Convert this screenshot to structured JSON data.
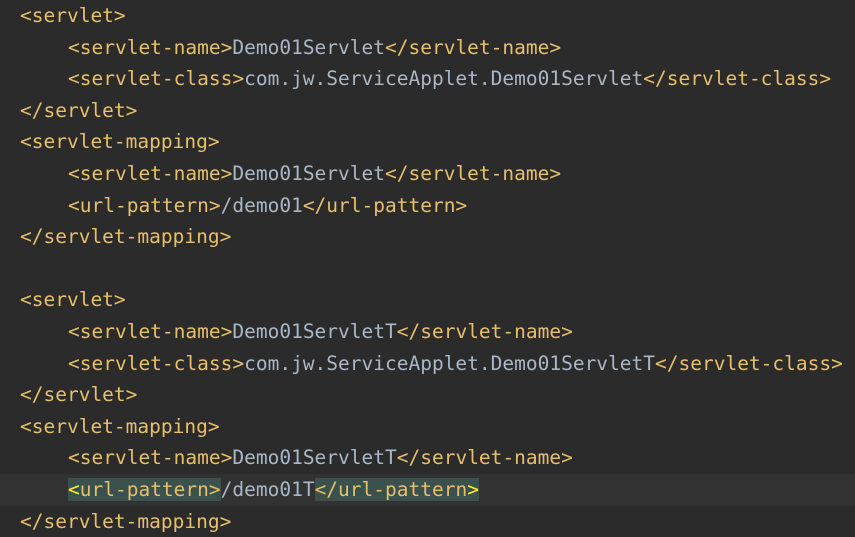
{
  "editor": {
    "lines": [
      {
        "indent": false,
        "open": "<servlet>",
        "text": "",
        "close": ""
      },
      {
        "indent": true,
        "open": "<servlet-name>",
        "text": "Demo01Servlet",
        "close": "</servlet-name>"
      },
      {
        "indent": true,
        "open": "<servlet-class>",
        "text": "com.jw.ServiceApplet.Demo01Servlet",
        "close": "</servlet-class>"
      },
      {
        "indent": false,
        "open": "</servlet>",
        "text": "",
        "close": ""
      },
      {
        "indent": false,
        "open": "<servlet-mapping>",
        "text": "",
        "close": ""
      },
      {
        "indent": true,
        "open": "<servlet-name>",
        "text": "Demo01Servlet",
        "close": "</servlet-name>"
      },
      {
        "indent": true,
        "open": "<url-pattern>",
        "text": "/demo01",
        "close": "</url-pattern>"
      },
      {
        "indent": false,
        "open": "</servlet-mapping>",
        "text": "",
        "close": ""
      },
      {
        "indent": false,
        "open": "",
        "text": "",
        "close": ""
      },
      {
        "indent": false,
        "open": "<servlet>",
        "text": "",
        "close": ""
      },
      {
        "indent": true,
        "open": "<servlet-name>",
        "text": "Demo01ServletT",
        "close": "</servlet-name>"
      },
      {
        "indent": true,
        "open": "<servlet-class>",
        "text": "com.jw.ServiceApplet.Demo01ServletT",
        "close": "</servlet-class>"
      },
      {
        "indent": false,
        "open": "</servlet>",
        "text": "",
        "close": ""
      },
      {
        "indent": false,
        "open": "<servlet-mapping>",
        "text": "",
        "close": ""
      },
      {
        "indent": true,
        "open": "<servlet-name>",
        "text": "Demo01ServletT",
        "close": "</servlet-name>"
      },
      {
        "indent": true,
        "open": "<url-pattern>",
        "text": "/demo01T",
        "close": "</url-pattern>"
      },
      {
        "indent": false,
        "open": "</servlet-mapping>",
        "text": "",
        "close": ""
      }
    ],
    "current_line": {
      "open_lt": "<",
      "open_name": "url-pattern",
      "open_gt": ">",
      "close_body": "</url-pattern",
      "close_gt": ">"
    }
  },
  "colors": {
    "background": "#2b2b2b",
    "current_line": "#323232",
    "tag": "#e8bf6a",
    "text": "#a9b7c6",
    "tag_highlight": "#3b514d",
    "brace_match": "#ffef28"
  }
}
